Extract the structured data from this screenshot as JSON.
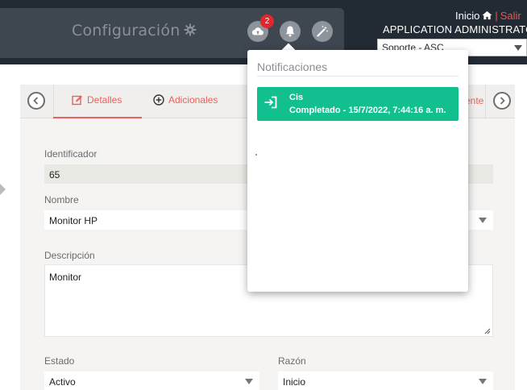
{
  "header": {
    "app_title": "Configuración",
    "upload_badge_count": "2",
    "inicio_label": "Inicio",
    "separator": "|",
    "salir_label": "Salir",
    "user_name": "APPLICATION ADMINISTRATOR",
    "role_value": "Soporte - ASC"
  },
  "tabs": {
    "detalles_label": "Detalles",
    "adicionales_label": "Adicionales",
    "partial_label": "ente",
    "active_color": "#e8615a"
  },
  "form": {
    "identificador_label": "Identificador",
    "identificador_value": "65",
    "nombre_label": "Nombre",
    "nombre_value": "Monitor HP",
    "descripcion_label": "Descripción",
    "descripcion_value": "Monitor",
    "estado_label": "Estado",
    "estado_value": "Activo",
    "razon_label": "Razón",
    "razon_value": "Inicio"
  },
  "notifications": {
    "title": "Notificaciones",
    "items": [
      {
        "name": "Cis",
        "status": "Completado - 15/7/2022, 7:44:16 a. m.",
        "color": "#12bf8e"
      }
    ]
  },
  "icons": {
    "gear": "gear-icon",
    "upload": "cloud-upload-icon",
    "bell": "bell-icon",
    "wand": "magic-wand-icon",
    "home": "home-icon",
    "edit": "edit-icon",
    "plus": "plus-circle-icon",
    "login": "sign-in-icon"
  }
}
